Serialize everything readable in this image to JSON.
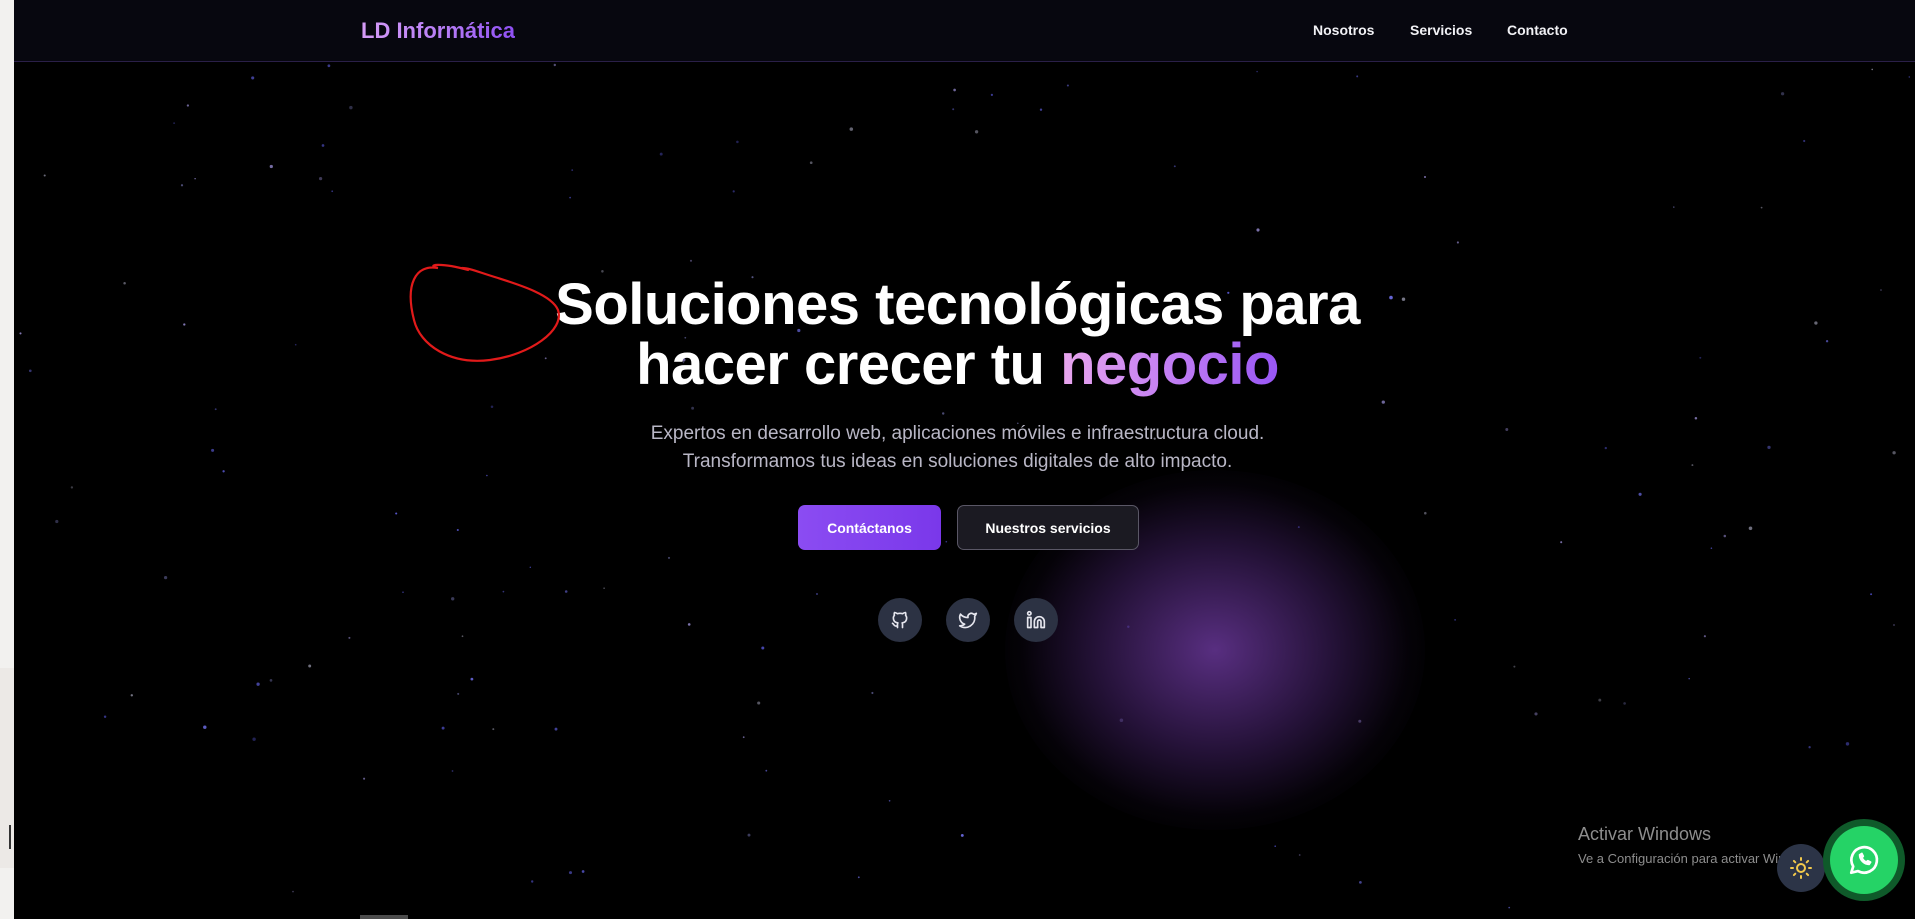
{
  "brand": {
    "name": "LD Informática"
  },
  "nav": {
    "items": [
      {
        "label": "Nosotros"
      },
      {
        "label": "Servicios"
      },
      {
        "label": "Contacto"
      }
    ]
  },
  "hero": {
    "title_line1": "Soluciones tecnológicas para",
    "title_line2_start": "hacer crecer tu ",
    "title_line2_accent": "negocio",
    "subtitle_line1": "Expertos en desarrollo web, aplicaciones móviles e infraestructura cloud.",
    "subtitle_line2": "Transformamos tus ideas en soluciones digitales de alto impacto."
  },
  "buttons": {
    "primary_label": "Contáctanos",
    "secondary_label": "Nuestros servicios"
  },
  "social": [
    {
      "icon": "github-icon"
    },
    {
      "icon": "twitter-icon"
    },
    {
      "icon": "linkedin-icon"
    }
  ],
  "windows_notice": {
    "title": "Activar Windows",
    "subtitle": "Ve a Configuración para activar Windows."
  },
  "colors": {
    "background": "#000000",
    "navbar": "#07070f",
    "accent_primary": "#8b4cf2",
    "accent_gradient_start": "#e9a6ee",
    "accent_gradient_end": "#9856f5",
    "annotation_red": "#e11a1a",
    "whatsapp_green": "#25d366"
  },
  "floating_buttons": {
    "theme_icon": "sun-icon",
    "chat_icon": "whatsapp-icon"
  }
}
